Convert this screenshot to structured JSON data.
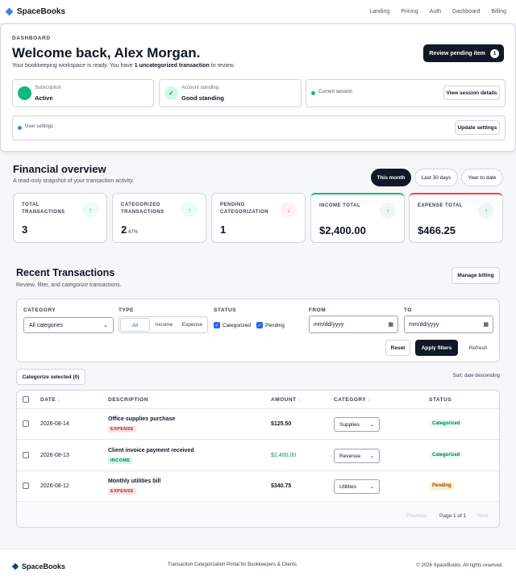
{
  "nav": {
    "brand": "SpaceBooks",
    "links": [
      "Landing",
      "Pricing",
      "Auth",
      "Dashboard",
      "Billing"
    ]
  },
  "dashboard": {
    "eyebrow": "DASHBOARD",
    "welcome": "Welcome back, Alex Morgan.",
    "sub_before": "Your bookkeeping workspace is ready. You have ",
    "sub_bold": "1 uncategorized transaction",
    "sub_after": " to review.",
    "review_button": "Review pending item",
    "review_count": "1",
    "subscription_label": "Subscription",
    "subscription_value": "Active",
    "account_label": "Account standing",
    "account_value": "Good standing",
    "session_label": "Current session",
    "session_button": "View session details",
    "user_label": "User settings",
    "user_button": "Update settings"
  },
  "financial": {
    "title": "Financial overview",
    "subtitle": "A read-only snapshot of your transaction activity.",
    "ranges": [
      "This month",
      "Last 30 days",
      "Year to date"
    ],
    "kpis": [
      {
        "label": "TOTAL TRANSACTIONS",
        "value": "3",
        "extra": ""
      },
      {
        "label": "CATEGORIZED TRANSACTIONS",
        "value": "2",
        "extra": "67%"
      },
      {
        "label": "PENDING CATEGORIZATION",
        "value": "1",
        "extra": ""
      },
      {
        "label": "INCOME TOTAL",
        "value": "$2,400.00",
        "extra": ""
      },
      {
        "label": "EXPENSE TOTAL",
        "value": "$466.25",
        "extra": ""
      }
    ]
  },
  "transactions": {
    "title": "Recent Transactions",
    "subtitle": "Review, filter, and categorize transactions.",
    "manage_billing": "Manage billing",
    "filters": {
      "category_label": "CATEGORY",
      "category_value": "All categories",
      "type_label": "TYPE",
      "types": [
        "All",
        "Income",
        "Expense"
      ],
      "status_label": "STATUS",
      "status_categorized": "Categorized",
      "status_pending": "Pending",
      "from_label": "FROM",
      "to_label": "TO",
      "date_placeholder": "mm/dd/yyyy",
      "reset": "Reset",
      "apply": "Apply filters",
      "refresh": "Refresh"
    },
    "categorize_selected": "Categorize selected (0)",
    "sort_note": "Sort: date descending",
    "columns": [
      "DATE",
      "DESCRIPTION",
      "AMOUNT",
      "CATEGORY",
      "STATUS"
    ],
    "rows": [
      {
        "date": "2026-08-14",
        "description": "Office supplies purchase",
        "type": "EXPENSE",
        "amount": "$125.50",
        "category": "Supplies",
        "status": "Categorized"
      },
      {
        "date": "2026-08-13",
        "description": "Client invoice payment received",
        "type": "INCOME",
        "amount": "$2,400.00",
        "category": "Revenue",
        "status": "Categorized"
      },
      {
        "date": "2026-08-12",
        "description": "Monthly utilities bill",
        "type": "EXPENSE",
        "amount": "$340.75",
        "category": "Utilities",
        "status": "Pending"
      }
    ],
    "pager": {
      "previous": "Previous",
      "page": "Page 1 of 1",
      "next": "Next"
    }
  },
  "footer": {
    "brand": "SpaceBooks",
    "tagline": "Transaction Categorization Portal for Bookkeepers & Clients",
    "copyright": "© 2026 SpaceBooks. All rights reserved."
  }
}
